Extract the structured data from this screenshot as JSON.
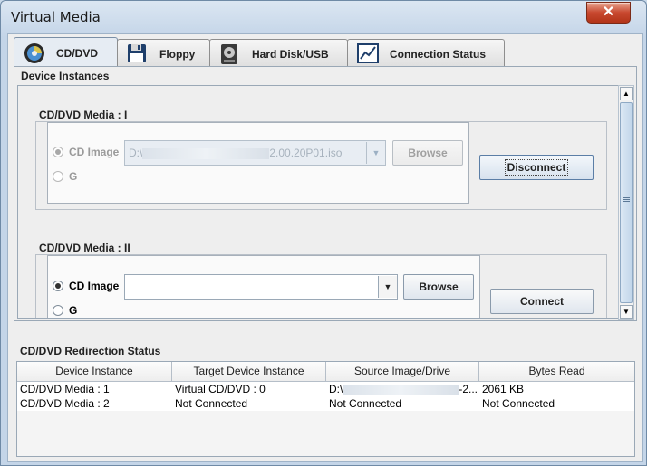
{
  "window": {
    "title": "Virtual Media",
    "close_glyph": "✕"
  },
  "tabs": [
    {
      "label": "CD/DVD",
      "icon": "cd-icon",
      "active": true
    },
    {
      "label": "Floppy",
      "icon": "floppy-icon",
      "active": false
    },
    {
      "label": "Hard Disk/USB",
      "icon": "hard-disk-icon",
      "active": false
    },
    {
      "label": "Connection Status",
      "icon": "chart-icon",
      "active": false
    }
  ],
  "device_instances": {
    "label": "Device Instances",
    "instances": [
      {
        "title": "CD/DVD Media : I",
        "cd_image_label": "CD Image",
        "drive_label": "G",
        "path_prefix": "D:\\",
        "path_suffix": "2.00.20P01.iso",
        "browse_label": "Browse",
        "action_label": "Disconnect",
        "enabled": false
      },
      {
        "title": "CD/DVD Media : II",
        "cd_image_label": "CD Image",
        "drive_label": "G",
        "path_prefix": "",
        "path_suffix": "",
        "browse_label": "Browse",
        "action_label": "Connect",
        "enabled": true
      }
    ]
  },
  "redirection_status": {
    "label": "CD/DVD Redirection Status",
    "columns": [
      "Device Instance",
      "Target Device Instance",
      "Source Image/Drive",
      "Bytes Read"
    ],
    "rows": [
      [
        "CD/DVD Media :  1",
        "Virtual CD/DVD : 0",
        "D:\\",
        "2061 KB"
      ],
      [
        "CD/DVD Media :  2",
        "Not Connected",
        "Not Connected",
        "Not Connected"
      ]
    ],
    "source_truncated_suffix": "-2..."
  }
}
